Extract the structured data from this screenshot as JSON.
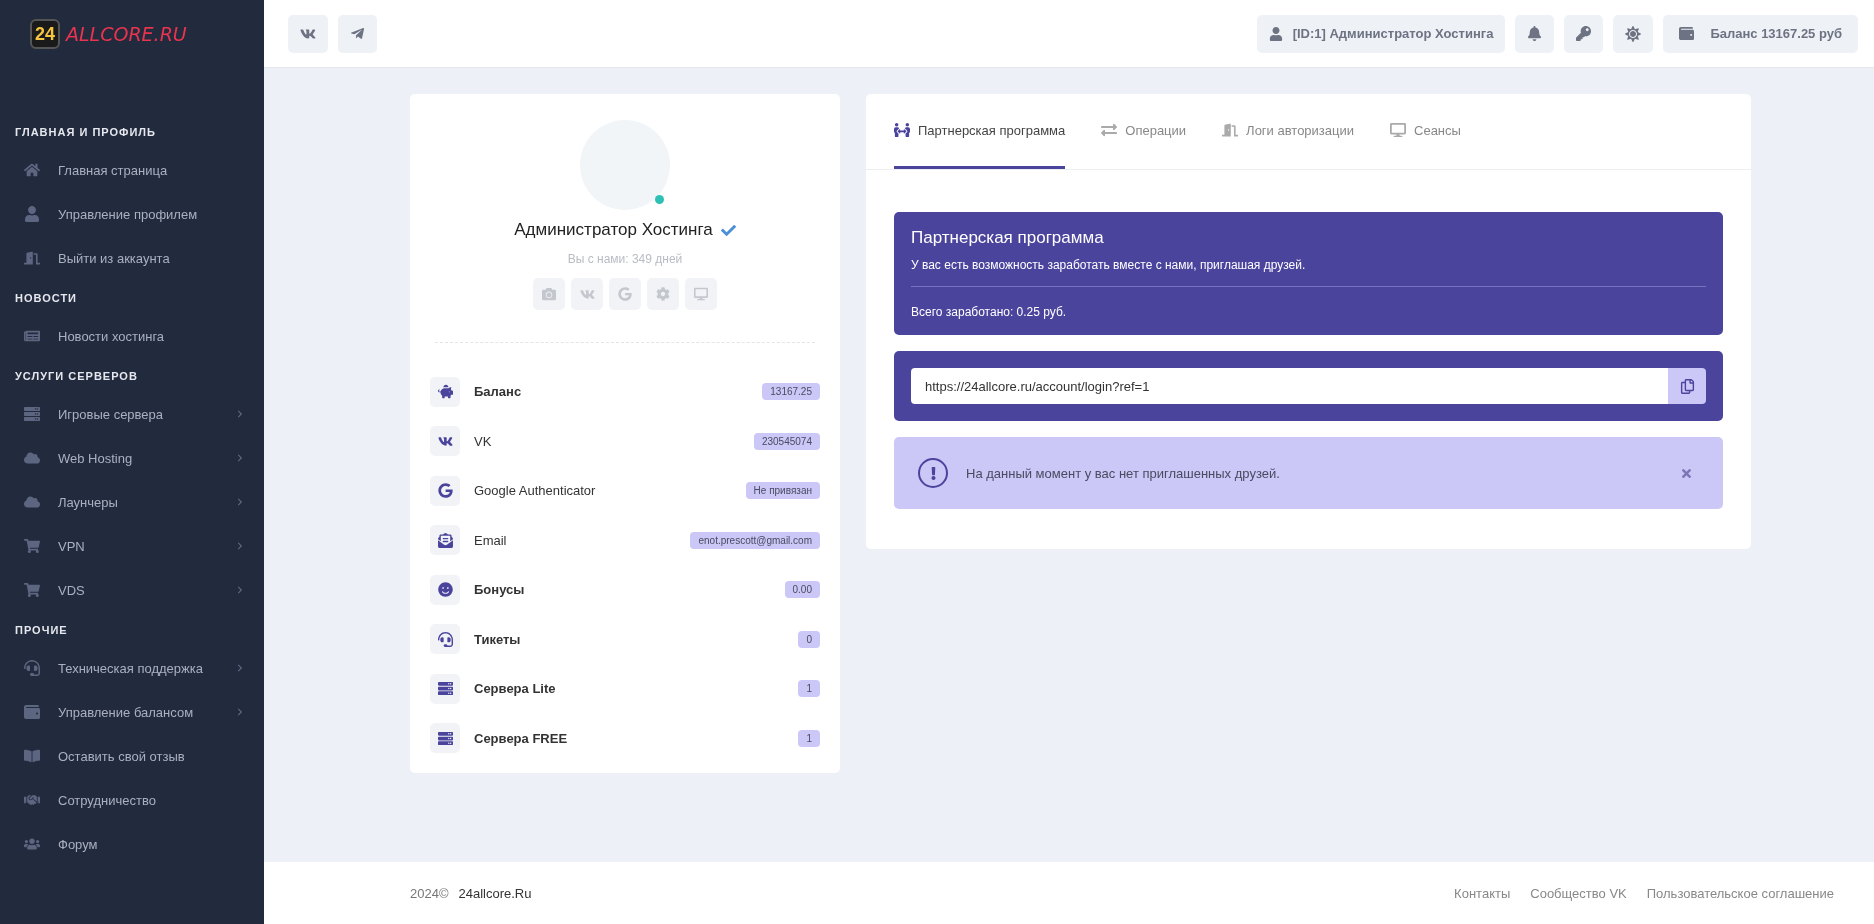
{
  "logo": {
    "badge": "24",
    "text": "ALLCORE.RU"
  },
  "sidebar": {
    "sections": [
      {
        "title": "ГЛАВНАЯ И ПРОФИЛЬ",
        "items": [
          {
            "label": "Главная страница",
            "kind": "home",
            "has_submenu": false
          },
          {
            "label": "Управление профилем",
            "kind": "user",
            "has_submenu": false
          },
          {
            "label": "Выйти из аккаунта",
            "kind": "door",
            "has_submenu": false
          }
        ]
      },
      {
        "title": "НОВОСТИ",
        "items": [
          {
            "label": "Новости хостинга",
            "kind": "news",
            "has_submenu": false
          }
        ]
      },
      {
        "title": "УСЛУГИ СЕРВЕРОВ",
        "items": [
          {
            "label": "Игровые сервера",
            "kind": "server",
            "has_submenu": true
          },
          {
            "label": "Web Hosting",
            "kind": "cloud",
            "has_submenu": true
          },
          {
            "label": "Лаунчеры",
            "kind": "cloud",
            "has_submenu": true
          },
          {
            "label": "VPN",
            "kind": "cart",
            "has_submenu": true
          },
          {
            "label": "VDS",
            "kind": "cart",
            "has_submenu": true
          }
        ]
      },
      {
        "title": "ПРОЧИЕ",
        "items": [
          {
            "label": "Техническая поддержка",
            "kind": "headset",
            "has_submenu": true
          },
          {
            "label": "Управление балансом",
            "kind": "wallet",
            "has_submenu": true
          },
          {
            "label": "Оставить свой отзыв",
            "kind": "book",
            "has_submenu": false
          },
          {
            "label": "Сотрудничество",
            "kind": "handshake",
            "has_submenu": false
          },
          {
            "label": "Форум",
            "kind": "users",
            "has_submenu": false
          }
        ]
      }
    ]
  },
  "topbar": {
    "user": "[ID:1] Администратор Хостинга",
    "balance": "Баланс 13167.25 руб"
  },
  "profile": {
    "name": "Администратор Хостинга",
    "verified": true,
    "online": true,
    "since": "Вы с нами: 349 дней",
    "stats": [
      {
        "label": "Баланс",
        "value": "13167.25",
        "kind": "piggy",
        "bold": true
      },
      {
        "label": "VK",
        "value": "230545074",
        "kind": "vk",
        "bold": false
      },
      {
        "label": "Google Authenticator",
        "value": "Не привязан",
        "kind": "google",
        "bold": false
      },
      {
        "label": "Email",
        "value": "enot.prescott@gmail.com",
        "kind": "mail",
        "bold": false
      },
      {
        "label": "Бонусы",
        "value": "0.00",
        "kind": "smile",
        "bold": true
      },
      {
        "label": "Тикеты",
        "value": "0",
        "kind": "headset",
        "bold": true
      },
      {
        "label": "Сервера Lite",
        "value": "1",
        "kind": "server",
        "bold": true
      },
      {
        "label": "Сервера FREE",
        "value": "1",
        "kind": "server",
        "bold": true
      }
    ]
  },
  "tabs": [
    {
      "label": "Партнерская программа",
      "kind": "people",
      "selected": true
    },
    {
      "label": "Операции",
      "kind": "repeat",
      "selected": false
    },
    {
      "label": "Логи авторизации",
      "kind": "door",
      "selected": false
    },
    {
      "label": "Сеансы",
      "kind": "screens",
      "selected": false
    }
  ],
  "partner": {
    "title": "Партнерская программа",
    "text": "У вас есть возможность заработать вместе с нами, приглашая друзей.",
    "earned": "Всего заработано: 0.25 руб.",
    "link": "https://24allcore.ru/account/login?ref=1",
    "notice": "На данный момент у вас нет приглашенных друзей."
  },
  "footer": {
    "copyright": "2024©",
    "site": "24allcore.Ru",
    "links": [
      "Контакты",
      "Сообщество VK",
      "Пользовательское соглашение"
    ]
  }
}
